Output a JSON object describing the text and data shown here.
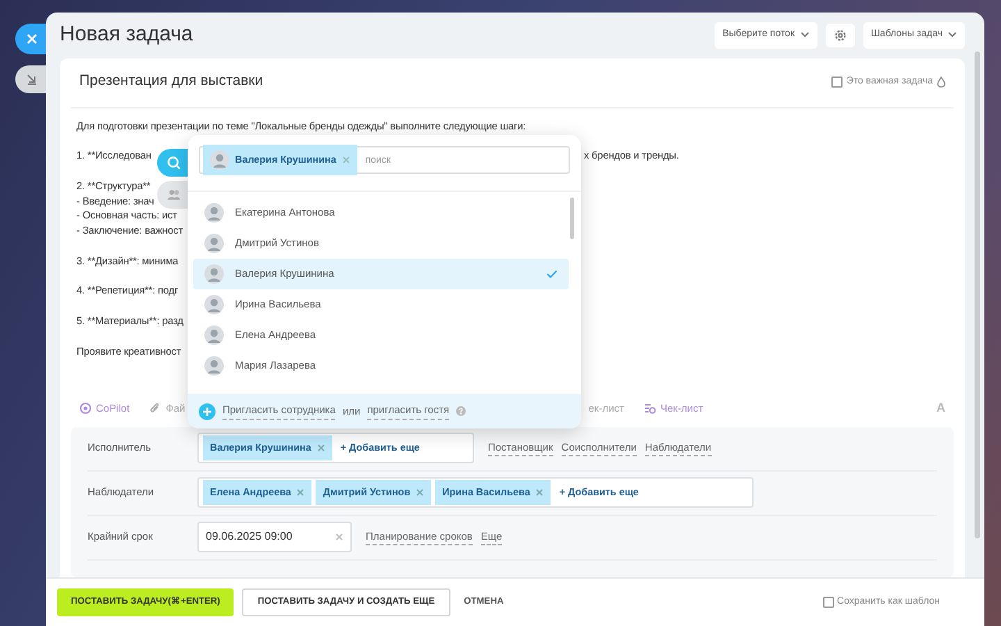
{
  "window": {
    "title": "Новая задача"
  },
  "header": {
    "flow_select": "Выберите поток",
    "templates": "Шаблоны задач"
  },
  "task": {
    "title": "Презентация для выставки",
    "important": {
      "label": "Это важная задача",
      "checked": false
    },
    "paragraphs": [
      [
        {
          "text": "Для подготовки презентации по теме \"Локальные бренды одежды\" выполните следующие шаги:"
        }
      ],
      [
        {
          "text": "1. **Исследован",
          "right_text": "х брендов и тренды."
        }
      ],
      [
        {
          "text": "2. **Структура**"
        },
        {
          "text": "- Введение: знач"
        },
        {
          "text": "- Основная часть: ист"
        },
        {
          "text": "- Заключение: важност"
        }
      ],
      [
        {
          "text": "3. **Дизайн**: минима"
        }
      ],
      [
        {
          "text": "4. **Репетиция**: подг"
        }
      ],
      [
        {
          "text": "5. **Материалы**: разд"
        }
      ],
      [
        {
          "text": "Проявите креативност"
        }
      ]
    ]
  },
  "toolbar": [
    {
      "label": "CoPilot",
      "kind": "copilot"
    },
    {
      "label": "Фай",
      "kind": "file"
    },
    {
      "label": "ек-лист",
      "kind": "text"
    },
    {
      "label": "Чек-лист",
      "kind": "checklist"
    },
    {
      "label": "A",
      "kind": "format"
    }
  ],
  "fields": [
    {
      "label": "Исполнитель",
      "kind": "people",
      "tags": [
        "Валерия Крушинина"
      ],
      "add": "+ Добавить еще",
      "links": [
        "Постановщик",
        "Соисполнители",
        "Наблюдатели"
      ]
    },
    {
      "label": "Наблюдатели",
      "kind": "people",
      "tags": [
        "Елена Андреева",
        "Дмитрий Устинов",
        "Ирина Васильева"
      ],
      "add": "+ Добавить еще"
    },
    {
      "label": "Крайний срок",
      "kind": "date",
      "value": "09.06.2025 09:00",
      "links": [
        "Планирование сроков",
        "Еще"
      ]
    }
  ],
  "popup": {
    "selected_tags": [
      "Валерия Крушинина"
    ],
    "search": {
      "placeholder": "поиск"
    },
    "people": [
      {
        "name": "Екатерина Антонова",
        "selected": false
      },
      {
        "name": "Дмитрий Устинов",
        "selected": false
      },
      {
        "name": "Валерия Крушинина",
        "selected": true
      },
      {
        "name": "Ирина Васильева",
        "selected": false
      },
      {
        "name": "Елена Андреева",
        "selected": false
      },
      {
        "name": "Мария Лазарева",
        "selected": false
      }
    ],
    "invite": {
      "employee": "Пригласить сотрудника",
      "or": "или",
      "guest": "пригласить гостя"
    }
  },
  "footer": {
    "primary": "ПОСТАВИТЬ ЗАДАЧУ(⌘+ENTER)",
    "secondary": "ПОСТАВИТЬ ЗАДАЧУ И СОЗДАТЬ ЕЩЕ",
    "cancel": "ОТМЕНА",
    "save_template": {
      "label": "Сохранить как шаблон",
      "checked": false
    }
  }
}
